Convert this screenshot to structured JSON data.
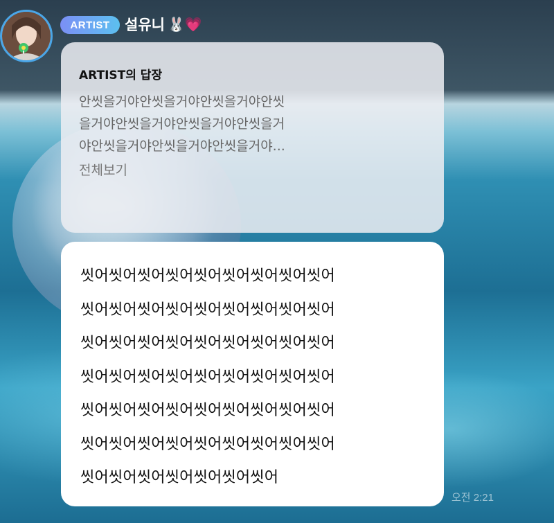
{
  "header": {
    "badge": "ARTIST",
    "name": "설유니",
    "name_emojis": "🐰💗"
  },
  "reply": {
    "title": "ARTIST의 답장",
    "lines": [
      "안씻을거야안씻을거야안씻을거야안씻",
      "을거야안씻을거야안씻을거야안씻을거",
      "야안씻을거야안씻을거야안씻을거야..."
    ],
    "see_all": "전체보기"
  },
  "message": {
    "lines": [
      "씻어씻어씻어씻어씻어씻어씻어씻어씻어",
      "씻어씻어씻어씻어씻어씻어씻어씻어씻어",
      "씻어씻어씻어씻어씻어씻어씻어씻어씻어",
      "씻어씻어씻어씻어씻어씻어씻어씻어씻어",
      "씻어씻어씻어씻어씻어씻어씻어씻어씻어",
      "씻어씻어씻어씻어씻어씻어씻어씻어씻어",
      "씻어씻어씻어씻어씻어씻어씻어"
    ],
    "time": "오전 2:21"
  },
  "colors": {
    "badge_start": "#7b8ff5",
    "badge_end": "#5cc0f0",
    "avatar_ring": "#4aa6e8"
  }
}
